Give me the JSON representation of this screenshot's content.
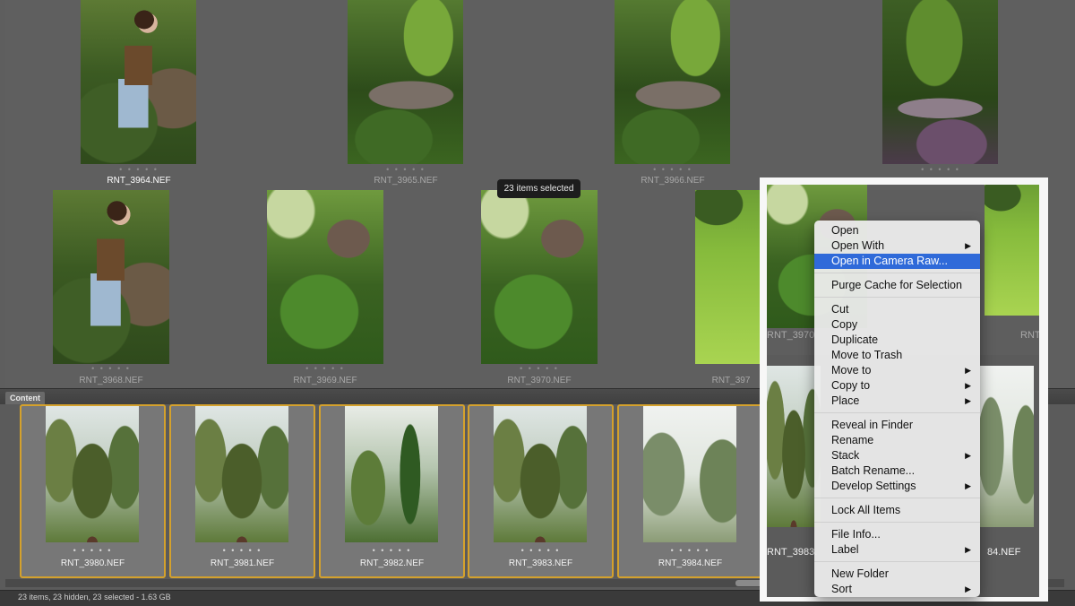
{
  "grid": {
    "row1": [
      {
        "name": "RNT_3964.NEF",
        "stars": "• • • • •",
        "selected": true
      },
      {
        "name": "RNT_3965.NEF",
        "stars": "• • • • •",
        "selected": false
      },
      {
        "name": "RNT_3966.NEF",
        "stars": "• • • • •",
        "selected": false
      },
      {
        "name": "",
        "stars": "• • • • •",
        "selected": false
      }
    ],
    "row2": [
      {
        "name": "RNT_3968.NEF",
        "stars": "• • • • •"
      },
      {
        "name": "RNT_3969.NEF",
        "stars": "• • • • •"
      },
      {
        "name": "RNT_3970.NEF",
        "stars": "• • • • •"
      },
      {
        "name": "RNT_397",
        "stars": ""
      }
    ],
    "tooltip": "23 items selected"
  },
  "content_panel": {
    "tab_label": "Content",
    "items": [
      {
        "name": "RNT_3980.NEF",
        "stars": "• • • • •"
      },
      {
        "name": "RNT_3981.NEF",
        "stars": "• • • • •"
      },
      {
        "name": "RNT_3982.NEF",
        "stars": "• • • • •"
      },
      {
        "name": "RNT_3983.NEF",
        "stars": "• • • • •"
      },
      {
        "name": "RNT_3984.NEF",
        "stars": "• • • • •"
      }
    ]
  },
  "status_bar": {
    "text": "23 items, 23 hidden, 23 selected - 1.63 GB"
  },
  "frame": {
    "labels": {
      "top_left": "RNT_3970.",
      "top_right": "RNT",
      "bottom_left": "RNT_3983.",
      "bottom_right": "84.NEF"
    }
  },
  "context_menu": {
    "highlight_color": "#2f6ad9",
    "items": {
      "open": "Open",
      "open_with": "Open With",
      "open_camera_raw": "Open in Camera Raw...",
      "purge_cache": "Purge Cache for Selection",
      "cut": "Cut",
      "copy": "Copy",
      "duplicate": "Duplicate",
      "move_to_trash": "Move to Trash",
      "move_to": "Move to",
      "copy_to": "Copy to",
      "place": "Place",
      "reveal_in_finder": "Reveal in Finder",
      "rename": "Rename",
      "stack": "Stack",
      "batch_rename": "Batch Rename...",
      "develop_settings": "Develop Settings",
      "lock_all_items": "Lock All Items",
      "file_info": "File Info...",
      "label": "Label",
      "new_folder": "New Folder",
      "sort": "Sort"
    },
    "submenu_arrow": "▶"
  }
}
